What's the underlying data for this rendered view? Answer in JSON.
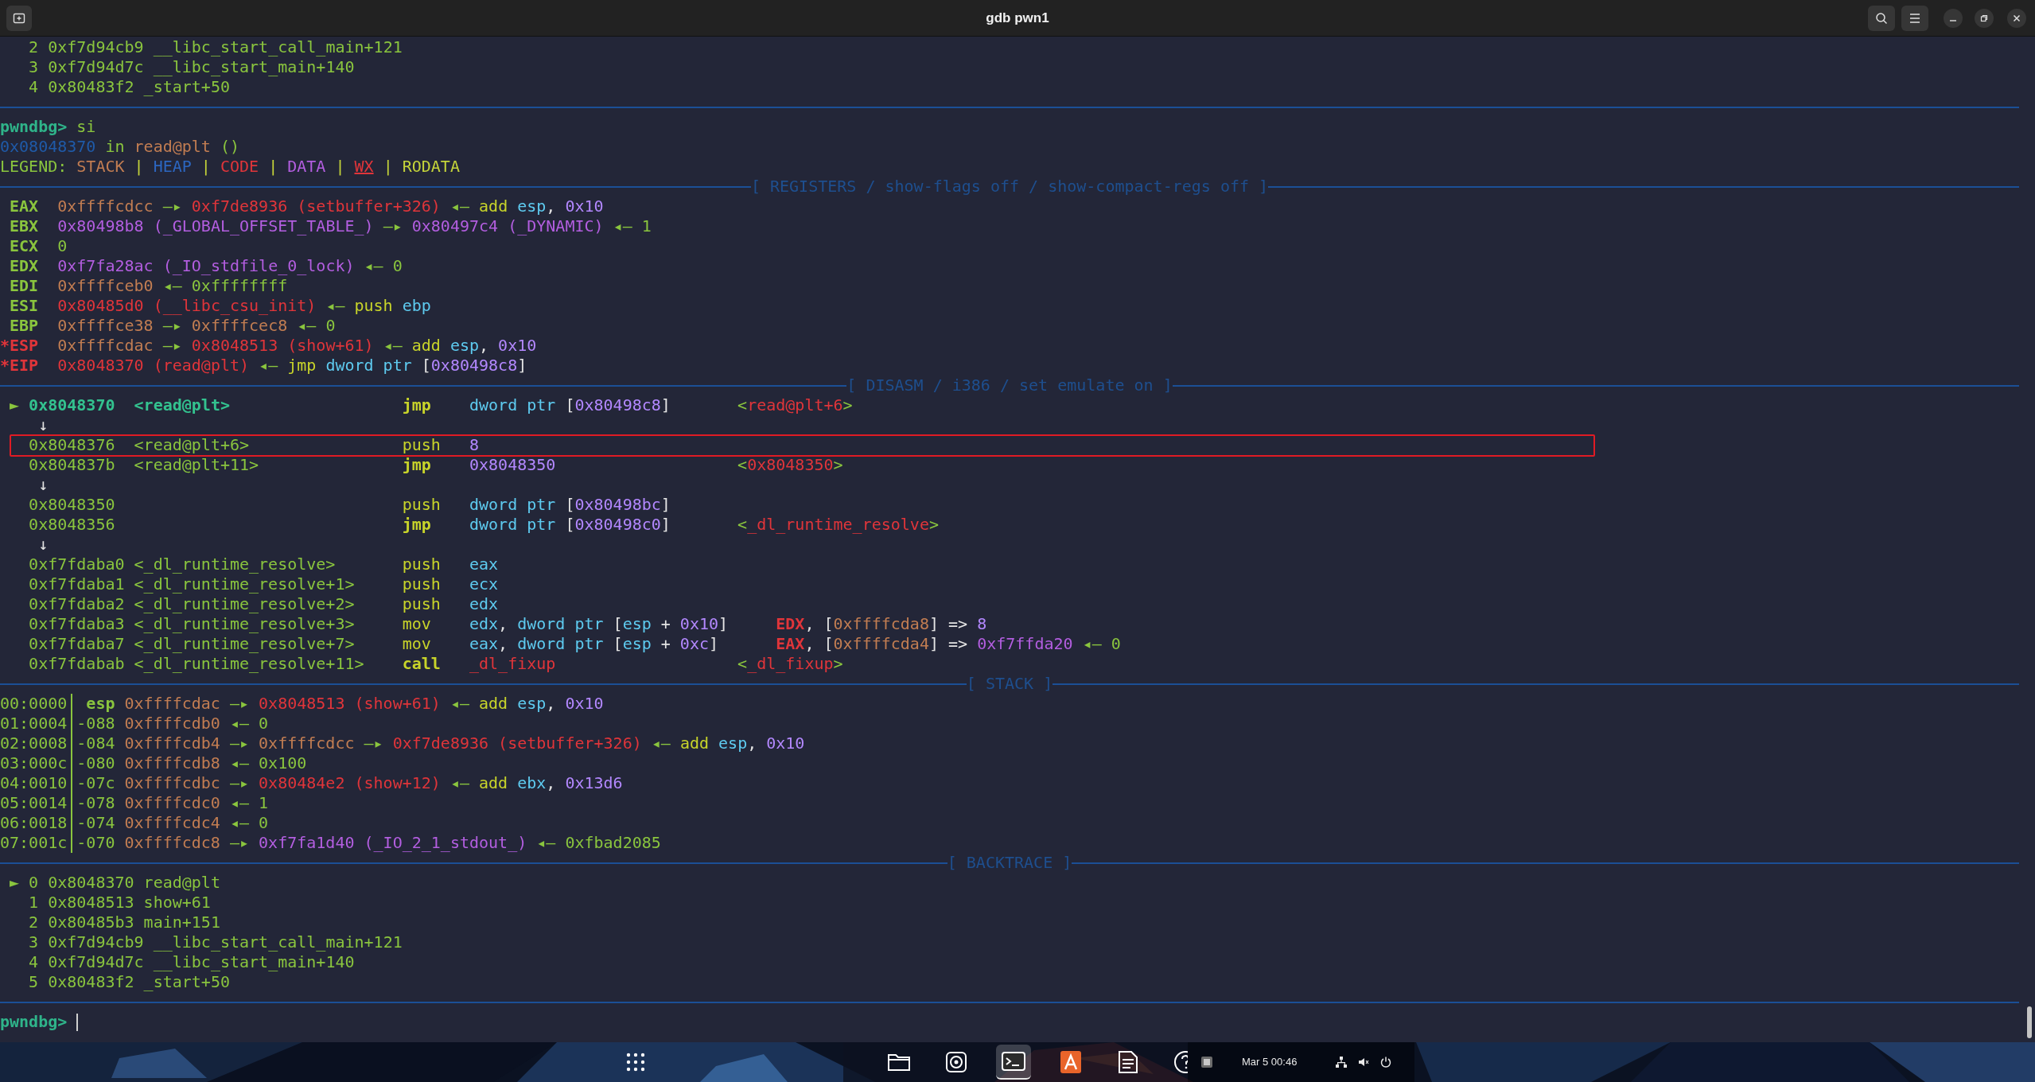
{
  "window": {
    "title": "gdb pwn1"
  },
  "scrollback": [
    {
      "frame": "2",
      "address": "0xf7d94cb9",
      "symbol": "__libc_start_call_main+121"
    },
    {
      "frame": "3",
      "address": "0xf7d94d7c",
      "symbol": "__libc_start_main+140"
    },
    {
      "frame": "4",
      "address": "0x80483f2",
      "symbol": "_start+50"
    }
  ],
  "command": {
    "prompt": "pwndbg>",
    "text": "si"
  },
  "location": [
    {
      "t": "0x08048370",
      "kind": "dim"
    },
    {
      "t": "in",
      "kind": "green"
    },
    {
      "t": "read@plt",
      "kind": "stack"
    },
    {
      "t": "()",
      "kind": "green"
    }
  ],
  "legend": [
    {
      "t": "LEGEND:",
      "kind": "green"
    },
    {
      "t": "STACK",
      "kind": "stack"
    },
    {
      "t": "|",
      "kind": "rodata"
    },
    {
      "t": "HEAP",
      "kind": "heap"
    },
    {
      "t": "|",
      "kind": "rodata"
    },
    {
      "t": "CODE",
      "kind": "code"
    },
    {
      "t": "|",
      "kind": "rodata"
    },
    {
      "t": "DATA",
      "kind": "data"
    },
    {
      "t": "|",
      "kind": "rodata"
    },
    {
      "t": "WX",
      "kind": "wx"
    },
    {
      "t": "|",
      "kind": "rodata"
    },
    {
      "t": "RODATA",
      "kind": "rodata"
    }
  ],
  "registers": {
    "title": "[ REGISTERS / show-flags off / show-compact-regs off ]",
    "rows": [
      {
        "name": "EAX",
        "changed": false,
        "value": [
          {
            "t": "0xffffcdcc",
            "kind": "stack"
          },
          {
            "t": "—▸",
            "kind": "arrow"
          },
          {
            "t": "0xf7de8936",
            "kind": "code"
          },
          {
            "t": "(setbuffer+326)",
            "kind": "code"
          },
          {
            "t": "◂—",
            "kind": "arrow"
          },
          {
            "t": "add",
            "kind": "mnem"
          },
          {
            "parts": [
              {
                "t": "esp",
                "kind": "reg"
              },
              {
                "t": ",",
                "kind": "bright"
              }
            ]
          },
          {
            "t": "0x10",
            "kind": "num"
          }
        ]
      },
      {
        "name": "EBX",
        "changed": false,
        "value": [
          {
            "t": "0x80498b8",
            "kind": "data"
          },
          {
            "t": "(_GLOBAL_OFFSET_TABLE_)",
            "kind": "data"
          },
          {
            "t": "—▸",
            "kind": "arrow"
          },
          {
            "t": "0x80497c4",
            "kind": "data"
          },
          {
            "t": "(_DYNAMIC)",
            "kind": "data"
          },
          {
            "t": "◂—",
            "kind": "arrow"
          },
          {
            "t": "1",
            "kind": "green"
          }
        ]
      },
      {
        "name": "ECX",
        "changed": false,
        "value": [
          {
            "t": "0",
            "kind": "green"
          }
        ]
      },
      {
        "name": "EDX",
        "changed": false,
        "value": [
          {
            "t": "0xf7fa28ac",
            "kind": "data"
          },
          {
            "t": "(_IO_stdfile_0_lock)",
            "kind": "data"
          },
          {
            "t": "◂—",
            "kind": "arrow"
          },
          {
            "t": "0",
            "kind": "green"
          }
        ]
      },
      {
        "name": "EDI",
        "changed": false,
        "value": [
          {
            "t": "0xffffceb0",
            "kind": "stack"
          },
          {
            "t": "◂—",
            "kind": "arrow"
          },
          {
            "t": "0xffffffff",
            "kind": "green"
          }
        ]
      },
      {
        "name": "ESI",
        "changed": false,
        "value": [
          {
            "t": "0x80485d0",
            "kind": "code"
          },
          {
            "t": "(__libc_csu_init)",
            "kind": "code"
          },
          {
            "t": "◂—",
            "kind": "arrow"
          },
          {
            "t": "push",
            "kind": "mnem"
          },
          {
            "t": "ebp",
            "kind": "reg"
          }
        ]
      },
      {
        "name": "EBP",
        "changed": false,
        "value": [
          {
            "t": "0xffffce38",
            "kind": "stack"
          },
          {
            "t": "—▸",
            "kind": "arrow"
          },
          {
            "t": "0xffffcec8",
            "kind": "stack"
          },
          {
            "t": "◂—",
            "kind": "arrow"
          },
          {
            "t": "0",
            "kind": "green"
          }
        ]
      },
      {
        "name": "*ESP",
        "changed": true,
        "value": [
          {
            "t": "0xffffcdac",
            "kind": "stack"
          },
          {
            "t": "—▸",
            "kind": "arrow"
          },
          {
            "t": "0x8048513",
            "kind": "code"
          },
          {
            "t": "(show+61)",
            "kind": "code"
          },
          {
            "t": "◂—",
            "kind": "arrow"
          },
          {
            "t": "add",
            "kind": "mnem"
          },
          {
            "parts": [
              {
                "t": "esp",
                "kind": "reg"
              },
              {
                "t": ",",
                "kind": "bright"
              }
            ]
          },
          {
            "t": "0x10",
            "kind": "num"
          }
        ]
      },
      {
        "name": "*EIP",
        "changed": true,
        "value": [
          {
            "t": "0x8048370",
            "kind": "code"
          },
          {
            "t": "(read@plt)",
            "kind": "code"
          },
          {
            "t": "◂—",
            "kind": "arrow"
          },
          {
            "t": "jmp",
            "kind": "mnem"
          },
          {
            "t": "dword ptr",
            "kind": "reg"
          },
          {
            "parts": [
              {
                "t": "[",
                "kind": "bright"
              },
              {
                "t": "0x80498c8",
                "kind": "num"
              },
              {
                "t": "]",
                "kind": "bright"
              }
            ]
          }
        ]
      }
    ]
  },
  "disasm": {
    "title": "[ DISASM / i386 / set emulate on ]",
    "rows": [
      {
        "kind": "instruction",
        "current": true,
        "highlighted": false,
        "marker": "►",
        "address": "0x8048370",
        "symbol": "<read@plt>",
        "branch": true,
        "mnemonic": "jmp",
        "operands": [
          {
            "t": "dword ptr",
            "kind": "reg"
          },
          {
            "parts": [
              {
                "t": "[",
                "kind": "bright"
              },
              {
                "t": "0x80498c8",
                "kind": "num"
              },
              {
                "t": "]",
                "kind": "bright"
              }
            ]
          }
        ],
        "comment": {
          "kind": "target",
          "tokens": [
            {
              "parts": [
                {
                  "t": "<",
                  "kind": "green"
                },
                {
                  "t": "read@plt+6",
                  "kind": "code"
                },
                {
                  "t": ">",
                  "kind": "green"
                }
              ]
            }
          ]
        }
      },
      {
        "kind": "flow",
        "text": "↓"
      },
      {
        "kind": "instruction",
        "current": false,
        "highlighted": true,
        "address": "0x8048376",
        "symbol": "<read@plt+6>",
        "branch": false,
        "mnemonic": "push",
        "operands": [
          {
            "t": "8",
            "kind": "num"
          }
        ]
      },
      {
        "kind": "instruction",
        "current": false,
        "highlighted": false,
        "address": "0x804837b",
        "symbol": "<read@plt+11>",
        "branch": true,
        "mnemonic": "jmp",
        "operands": [
          {
            "t": "0x8048350",
            "kind": "num"
          }
        ],
        "comment": {
          "kind": "target",
          "tokens": [
            {
              "parts": [
                {
                  "t": "<",
                  "kind": "green"
                },
                {
                  "t": "0x8048350",
                  "kind": "code"
                },
                {
                  "t": ">",
                  "kind": "green"
                }
              ]
            }
          ]
        }
      },
      {
        "kind": "flow",
        "text": "↓"
      },
      {
        "kind": "instruction",
        "current": false,
        "highlighted": false,
        "address": "0x8048350",
        "branch": false,
        "mnemonic": "push",
        "operands": [
          {
            "t": "dword ptr",
            "kind": "reg"
          },
          {
            "parts": [
              {
                "t": "[",
                "kind": "bright"
              },
              {
                "t": "0x80498bc",
                "kind": "num"
              },
              {
                "t": "]",
                "kind": "bright"
              }
            ]
          }
        ]
      },
      {
        "kind": "instruction",
        "current": false,
        "highlighted": false,
        "address": "0x8048356",
        "branch": true,
        "mnemonic": "jmp",
        "operands": [
          {
            "t": "dword ptr",
            "kind": "reg"
          },
          {
            "parts": [
              {
                "t": "[",
                "kind": "bright"
              },
              {
                "t": "0x80498c0",
                "kind": "num"
              },
              {
                "t": "]",
                "kind": "bright"
              }
            ]
          }
        ],
        "comment": {
          "kind": "target",
          "tokens": [
            {
              "parts": [
                {
                  "t": "<",
                  "kind": "green"
                },
                {
                  "t": "_dl_runtime_resolve",
                  "kind": "code"
                },
                {
                  "t": ">",
                  "kind": "green"
                }
              ]
            }
          ]
        }
      },
      {
        "kind": "flow",
        "text": "↓"
      },
      {
        "kind": "instruction",
        "current": false,
        "highlighted": false,
        "address": "0xf7fdaba0",
        "symbol": "<_dl_runtime_resolve>",
        "branch": false,
        "mnemonic": "push",
        "operands": [
          {
            "t": "eax",
            "kind": "reg"
          }
        ]
      },
      {
        "kind": "instruction",
        "current": false,
        "highlighted": false,
        "address": "0xf7fdaba1",
        "symbol": "<_dl_runtime_resolve+1>",
        "branch": false,
        "mnemonic": "push",
        "operands": [
          {
            "t": "ecx",
            "kind": "reg"
          }
        ]
      },
      {
        "kind": "instruction",
        "current": false,
        "highlighted": false,
        "address": "0xf7fdaba2",
        "symbol": "<_dl_runtime_resolve+2>",
        "branch": false,
        "mnemonic": "push",
        "operands": [
          {
            "t": "edx",
            "kind": "reg"
          }
        ]
      },
      {
        "kind": "instruction",
        "current": false,
        "highlighted": false,
        "address": "0xf7fdaba3",
        "symbol": "<_dl_runtime_resolve+3>",
        "branch": false,
        "mnemonic": "mov",
        "operands": [
          {
            "parts": [
              {
                "t": "edx",
                "kind": "reg"
              },
              {
                "t": ",",
                "kind": "bright"
              }
            ]
          },
          {
            "t": "dword ptr",
            "kind": "reg"
          },
          {
            "parts": [
              {
                "t": "[",
                "kind": "bright"
              },
              {
                "t": "esp",
                "kind": "reg"
              }
            ]
          },
          {
            "t": "+",
            "kind": "bright"
          },
          {
            "parts": [
              {
                "t": "0x10",
                "kind": "num"
              },
              {
                "t": "]",
                "kind": "bright"
              }
            ]
          }
        ],
        "comment": {
          "kind": "emulated",
          "tokens": [
            {
              "parts": [
                {
                  "t": "EDX",
                  "kind": "flag"
                },
                {
                  "t": ",",
                  "kind": "bright"
                }
              ]
            },
            {
              "parts": [
                {
                  "t": "[",
                  "kind": "bright"
                },
                {
                  "t": "0xffffcda8",
                  "kind": "stack"
                },
                {
                  "t": "]",
                  "kind": "bright"
                }
              ]
            },
            {
              "t": "=>",
              "kind": "bright"
            },
            {
              "t": "8",
              "kind": "num"
            }
          ]
        }
      },
      {
        "kind": "instruction",
        "current": false,
        "highlighted": false,
        "address": "0xf7fdaba7",
        "symbol": "<_dl_runtime_resolve+7>",
        "branch": false,
        "mnemonic": "mov",
        "operands": [
          {
            "parts": [
              {
                "t": "eax",
                "kind": "reg"
              },
              {
                "t": ",",
                "kind": "bright"
              }
            ]
          },
          {
            "t": "dword ptr",
            "kind": "reg"
          },
          {
            "parts": [
              {
                "t": "[",
                "kind": "bright"
              },
              {
                "t": "esp",
                "kind": "reg"
              }
            ]
          },
          {
            "t": "+",
            "kind": "bright"
          },
          {
            "parts": [
              {
                "t": "0xc",
                "kind": "num"
              },
              {
                "t": "]",
                "kind": "bright"
              }
            ]
          }
        ],
        "comment": {
          "kind": "emulated",
          "tokens": [
            {
              "parts": [
                {
                  "t": "EAX",
                  "kind": "flag"
                },
                {
                  "t": ",",
                  "kind": "bright"
                }
              ]
            },
            {
              "parts": [
                {
                  "t": "[",
                  "kind": "bright"
                },
                {
                  "t": "0xffffcda4",
                  "kind": "stack"
                },
                {
                  "t": "]",
                  "kind": "bright"
                }
              ]
            },
            {
              "t": "=>",
              "kind": "bright"
            },
            {
              "t": "0xf7ffda20",
              "kind": "data"
            },
            {
              "t": "◂—",
              "kind": "arrow"
            },
            {
              "t": "0",
              "kind": "green"
            }
          ]
        }
      },
      {
        "kind": "instruction",
        "current": false,
        "highlighted": false,
        "address": "0xf7fdabab",
        "symbol": "<_dl_runtime_resolve+11>",
        "branch": true,
        "mnemonic": "call",
        "operands": [
          {
            "t": "_dl_fixup",
            "kind": "code"
          }
        ],
        "comment": {
          "kind": "target",
          "tokens": [
            {
              "parts": [
                {
                  "t": "<",
                  "kind": "green"
                },
                {
                  "t": "_dl_fixup",
                  "kind": "code"
                },
                {
                  "t": ">",
                  "kind": "green"
                }
              ]
            }
          ]
        }
      }
    ]
  },
  "stack": {
    "title": "[ STACK ]",
    "rows": [
      {
        "index": "00:0000",
        "offset": {
          "text": "esp",
          "kind": "register"
        },
        "value": [
          {
            "t": "0xffffcdac",
            "kind": "stack"
          },
          {
            "t": "—▸",
            "kind": "arrow"
          },
          {
            "t": "0x8048513",
            "kind": "code"
          },
          {
            "t": "(show+61)",
            "kind": "code"
          },
          {
            "t": "◂—",
            "kind": "arrow"
          },
          {
            "t": "add",
            "kind": "mnem"
          },
          {
            "parts": [
              {
                "t": "esp",
                "kind": "reg"
              },
              {
                "t": ",",
                "kind": "bright"
              }
            ]
          },
          {
            "t": "0x10",
            "kind": "num"
          }
        ]
      },
      {
        "index": "01:0004",
        "offset": {
          "text": "-088",
          "kind": "offset"
        },
        "value": [
          {
            "t": "0xffffcdb0",
            "kind": "stack"
          },
          {
            "t": "◂—",
            "kind": "arrow"
          },
          {
            "t": "0",
            "kind": "green"
          }
        ]
      },
      {
        "index": "02:0008",
        "offset": {
          "text": "-084",
          "kind": "offset"
        },
        "value": [
          {
            "t": "0xffffcdb4",
            "kind": "stack"
          },
          {
            "t": "—▸",
            "kind": "arrow"
          },
          {
            "t": "0xffffcdcc",
            "kind": "stack"
          },
          {
            "t": "—▸",
            "kind": "arrow"
          },
          {
            "t": "0xf7de8936",
            "kind": "code"
          },
          {
            "t": "(setbuffer+326)",
            "kind": "code"
          },
          {
            "t": "◂—",
            "kind": "arrow"
          },
          {
            "t": "add",
            "kind": "mnem"
          },
          {
            "parts": [
              {
                "t": "esp",
                "kind": "reg"
              },
              {
                "t": ",",
                "kind": "bright"
              }
            ]
          },
          {
            "t": "0x10",
            "kind": "num"
          }
        ]
      },
      {
        "index": "03:000c",
        "offset": {
          "text": "-080",
          "kind": "offset"
        },
        "value": [
          {
            "t": "0xffffcdb8",
            "kind": "stack"
          },
          {
            "t": "◂—",
            "kind": "arrow"
          },
          {
            "t": "0x100",
            "kind": "green"
          }
        ]
      },
      {
        "index": "04:0010",
        "offset": {
          "text": "-07c",
          "kind": "offset"
        },
        "value": [
          {
            "t": "0xffffcdbc",
            "kind": "stack"
          },
          {
            "t": "—▸",
            "kind": "arrow"
          },
          {
            "t": "0x80484e2",
            "kind": "code"
          },
          {
            "t": "(show+12)",
            "kind": "code"
          },
          {
            "t": "◂—",
            "kind": "arrow"
          },
          {
            "t": "add",
            "kind": "mnem"
          },
          {
            "parts": [
              {
                "t": "ebx",
                "kind": "reg"
              },
              {
                "t": ",",
                "kind": "bright"
              }
            ]
          },
          {
            "t": "0x13d6",
            "kind": "num"
          }
        ]
      },
      {
        "index": "05:0014",
        "offset": {
          "text": "-078",
          "kind": "offset"
        },
        "value": [
          {
            "t": "0xffffcdc0",
            "kind": "stack"
          },
          {
            "t": "◂—",
            "kind": "arrow"
          },
          {
            "t": "1",
            "kind": "green"
          }
        ]
      },
      {
        "index": "06:0018",
        "offset": {
          "text": "-074",
          "kind": "offset"
        },
        "value": [
          {
            "t": "0xffffcdc4",
            "kind": "stack"
          },
          {
            "t": "◂—",
            "kind": "arrow"
          },
          {
            "t": "0",
            "kind": "green"
          }
        ]
      },
      {
        "index": "07:001c",
        "offset": {
          "text": "-070",
          "kind": "offset"
        },
        "value": [
          {
            "t": "0xffffcdc8",
            "kind": "stack"
          },
          {
            "t": "—▸",
            "kind": "arrow"
          },
          {
            "t": "0xf7fa1d40",
            "kind": "data"
          },
          {
            "t": "(_IO_2_1_stdout_)",
            "kind": "data"
          },
          {
            "t": "◂—",
            "kind": "arrow"
          },
          {
            "t": "0xfbad2085",
            "kind": "green"
          }
        ]
      }
    ]
  },
  "backtrace": {
    "title": "[ BACKTRACE ]",
    "rows": [
      {
        "marker": "►",
        "frame": "0",
        "address": "0x8048370",
        "symbol": "read@plt"
      },
      {
        "frame": "1",
        "address": "0x8048513",
        "symbol": "show+61"
      },
      {
        "frame": "2",
        "address": "0x80485b3",
        "symbol": "main+151"
      },
      {
        "frame": "3",
        "address": "0xf7d94cb9",
        "symbol": "__libc_start_call_main+121"
      },
      {
        "frame": "4",
        "address": "0xf7d94d7c",
        "symbol": "__libc_start_main+140"
      },
      {
        "frame": "5",
        "address": "0x80483f2",
        "symbol": "_start+50"
      }
    ]
  },
  "input": {
    "prompt": "pwndbg>"
  },
  "dock": [
    {
      "kind": "folder",
      "selected": false
    },
    {
      "kind": "disc",
      "selected": false
    },
    {
      "kind": "terminal",
      "selected": true
    },
    {
      "kind": "store",
      "selected": false
    },
    {
      "kind": "document",
      "selected": false
    },
    {
      "kind": "help",
      "selected": false
    }
  ],
  "panel": {
    "clock": "Mar 5 00:46"
  }
}
